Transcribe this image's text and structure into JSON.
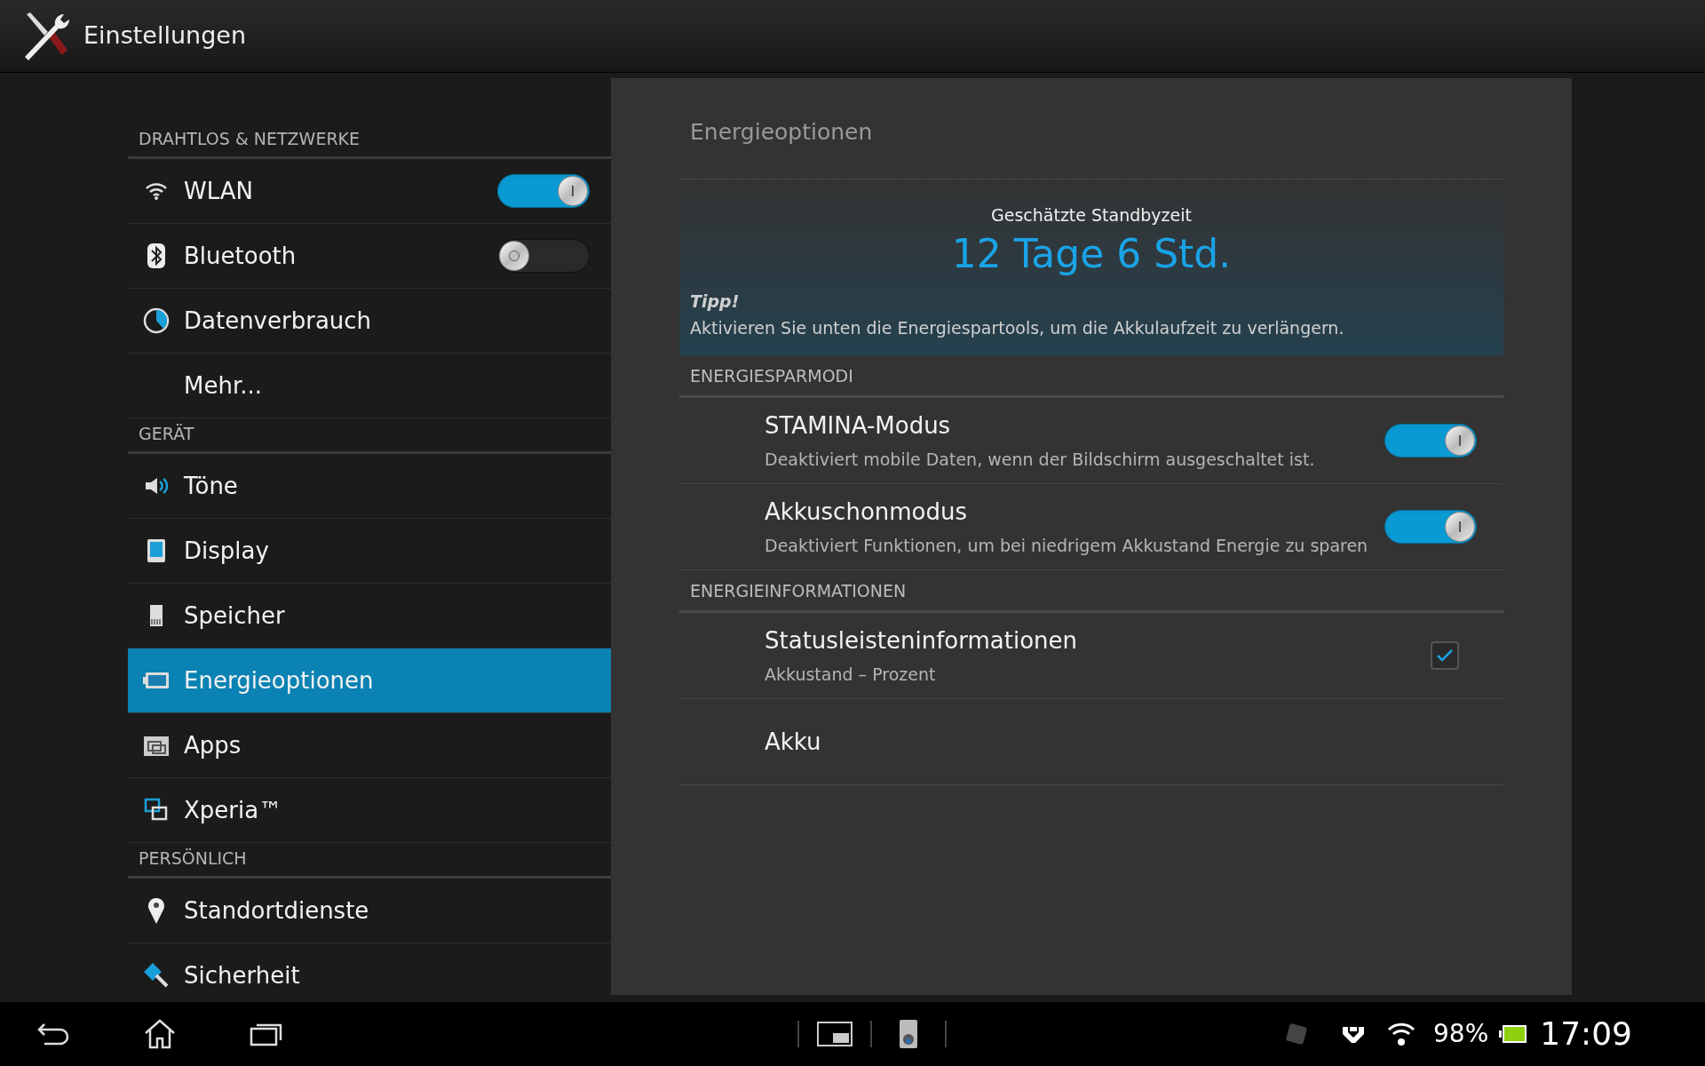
{
  "window": {
    "title": "Einstellungen"
  },
  "sidebar": {
    "sections": [
      {
        "header": "DRAHTLOS & NETZWERKE",
        "items": [
          {
            "label": "WLAN",
            "kind": "switch",
            "on": true,
            "selected": false
          },
          {
            "label": "Bluetooth",
            "kind": "switch",
            "on": false,
            "selected": false
          },
          {
            "label": "Datenverbrauch",
            "kind": "link",
            "selected": false
          },
          {
            "label": "Mehr...",
            "kind": "link",
            "selected": false
          }
        ]
      },
      {
        "header": "GERÄT",
        "items": [
          {
            "label": "Töne",
            "kind": "link",
            "selected": false
          },
          {
            "label": "Display",
            "kind": "link",
            "selected": false
          },
          {
            "label": "Speicher",
            "kind": "link",
            "selected": false
          },
          {
            "label": "Energieoptionen",
            "kind": "link",
            "selected": true
          },
          {
            "label": "Apps",
            "kind": "link",
            "selected": false
          },
          {
            "label": "Xperia™",
            "kind": "link",
            "selected": false
          }
        ]
      },
      {
        "header": "PERSÖNLICH",
        "items": [
          {
            "label": "Standortdienste",
            "kind": "link",
            "selected": false
          },
          {
            "label": "Sicherheit",
            "kind": "link",
            "selected": false
          }
        ]
      }
    ]
  },
  "panel": {
    "title": "Energieoptionen",
    "standby": {
      "label": "Geschätzte Standbyzeit",
      "value": "12 Tage 6 Std.",
      "tip_title": "Tipp!",
      "tip": "Aktivieren Sie unten die Energiespartools, um die Akkulaufzeit zu verlängern."
    },
    "sections": [
      {
        "header": "ENERGIESPARMODI",
        "rows": [
          {
            "kind": "switch",
            "title": "STAMINA-Modus",
            "subtitle": "Deaktiviert mobile Daten, wenn der Bildschirm ausgeschaltet ist.",
            "on": true
          },
          {
            "kind": "switch",
            "title": "Akkuschonmodus",
            "subtitle": "Deaktiviert Funktionen, um bei niedrigem Akkustand Energie zu sparen",
            "on": true
          }
        ]
      },
      {
        "header": "ENERGIEINFORMATIONEN",
        "rows": [
          {
            "kind": "checkbox",
            "title": "Statusleisteninformationen",
            "subtitle": "Akkustand – Prozent",
            "checked": true
          },
          {
            "kind": "link",
            "title": "Akku"
          }
        ]
      }
    ]
  },
  "status_bar": {
    "battery": "98%",
    "time": "17:09"
  }
}
